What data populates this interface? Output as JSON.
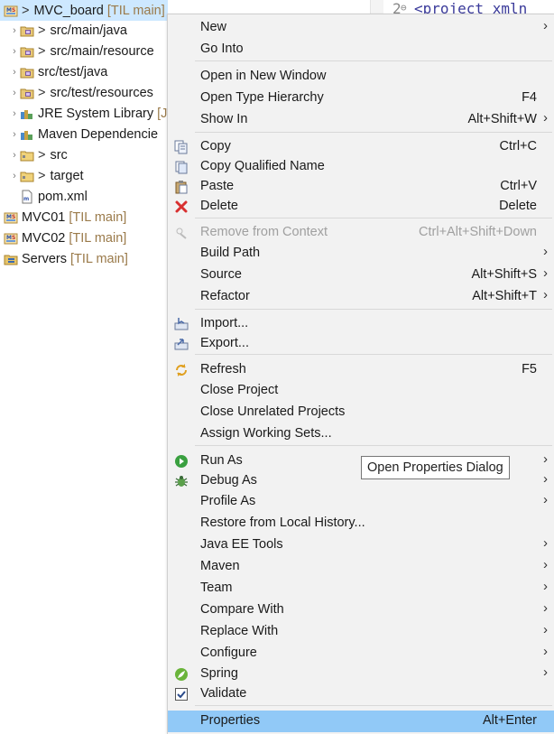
{
  "explorer": {
    "items": [
      {
        "name": "tree-item-mvc-board",
        "icon": "maven-project-icon",
        "label": "MVC_board",
        "suffix": "[TIL main]",
        "prefix": ">",
        "chevron": "",
        "selected": true
      },
      {
        "name": "tree-item-src-main-java",
        "icon": "source-folder-icon",
        "label": "src/main/java",
        "prefix": ">",
        "chevron": "›"
      },
      {
        "name": "tree-item-src-main-resources",
        "icon": "source-folder-icon",
        "label": "src/main/resource",
        "prefix": ">",
        "chevron": "›"
      },
      {
        "name": "tree-item-src-test-java",
        "icon": "source-folder-icon",
        "label": "src/test/java",
        "prefix": "",
        "chevron": "›"
      },
      {
        "name": "tree-item-src-test-resources",
        "icon": "source-folder-icon",
        "label": "src/test/resources",
        "prefix": ">",
        "chevron": "›"
      },
      {
        "name": "tree-item-jre-system-library",
        "icon": "library-icon",
        "label": "JRE System Library",
        "suffix": "[J",
        "prefix": "",
        "chevron": "›"
      },
      {
        "name": "tree-item-maven-dependencies",
        "icon": "library-icon",
        "label": "Maven Dependencie",
        "prefix": "",
        "chevron": "›"
      },
      {
        "name": "tree-item-src",
        "icon": "folder-icon",
        "label": "src",
        "prefix": ">",
        "chevron": "›"
      },
      {
        "name": "tree-item-target",
        "icon": "folder-icon",
        "label": "target",
        "prefix": ">",
        "chevron": "›"
      },
      {
        "name": "tree-item-pom-xml",
        "icon": "xml-file-icon",
        "label": "pom.xml",
        "prefix": "",
        "chevron": ""
      },
      {
        "name": "tree-item-mvc01",
        "icon": "maven-project-icon",
        "label": "MVC01",
        "suffix": "[TIL main]",
        "prefix": "",
        "chevron": ""
      },
      {
        "name": "tree-item-mvc02",
        "icon": "maven-project-icon",
        "label": "MVC02",
        "suffix": "[TIL main]",
        "prefix": "",
        "chevron": ""
      },
      {
        "name": "tree-item-servers",
        "icon": "servers-folder-icon",
        "label": "Servers",
        "suffix": "[TIL main]",
        "prefix": "",
        "chevron": ""
      }
    ]
  },
  "editor": {
    "line_number": "2",
    "fold_marker": "⊖",
    "code": "<project xmln"
  },
  "menu": {
    "items": [
      {
        "name": "menu-item-new",
        "label": "New",
        "shortcut": "",
        "submenu": true,
        "icon": ""
      },
      {
        "name": "menu-item-go-into",
        "label": "Go Into",
        "shortcut": "",
        "submenu": false,
        "icon": ""
      },
      {
        "sep": true
      },
      {
        "name": "menu-item-open-in-new-window",
        "label": "Open in New Window",
        "shortcut": "",
        "submenu": false,
        "icon": ""
      },
      {
        "name": "menu-item-open-type-hierarchy",
        "label": "Open Type Hierarchy",
        "shortcut": "F4",
        "submenu": false,
        "icon": ""
      },
      {
        "name": "menu-item-show-in",
        "label": "Show In",
        "shortcut": "Alt+Shift+W",
        "submenu": true,
        "icon": ""
      },
      {
        "sep": true
      },
      {
        "name": "menu-item-copy",
        "label": "Copy",
        "shortcut": "Ctrl+C",
        "submenu": false,
        "icon": "copy-icon"
      },
      {
        "name": "menu-item-copy-qualified-name",
        "label": "Copy Qualified Name",
        "shortcut": "",
        "submenu": false,
        "icon": "copy-qualified-icon"
      },
      {
        "name": "menu-item-paste",
        "label": "Paste",
        "shortcut": "Ctrl+V",
        "submenu": false,
        "icon": "paste-icon"
      },
      {
        "name": "menu-item-delete",
        "label": "Delete",
        "shortcut": "Delete",
        "submenu": false,
        "icon": "delete-icon"
      },
      {
        "sep": true
      },
      {
        "name": "menu-item-remove-from-context",
        "label": "Remove from Context",
        "shortcut": "Ctrl+Alt+Shift+Down",
        "submenu": false,
        "icon": "remove-context-icon",
        "disabled": true
      },
      {
        "name": "menu-item-build-path",
        "label": "Build Path",
        "shortcut": "",
        "submenu": true,
        "icon": ""
      },
      {
        "name": "menu-item-source",
        "label": "Source",
        "shortcut": "Alt+Shift+S",
        "submenu": true,
        "icon": ""
      },
      {
        "name": "menu-item-refactor",
        "label": "Refactor",
        "shortcut": "Alt+Shift+T",
        "submenu": true,
        "icon": ""
      },
      {
        "sep": true
      },
      {
        "name": "menu-item-import",
        "label": "Import...",
        "shortcut": "",
        "submenu": false,
        "icon": "import-icon"
      },
      {
        "name": "menu-item-export",
        "label": "Export...",
        "shortcut": "",
        "submenu": false,
        "icon": "export-icon"
      },
      {
        "sep": true
      },
      {
        "name": "menu-item-refresh",
        "label": "Refresh",
        "shortcut": "F5",
        "submenu": false,
        "icon": "refresh-icon"
      },
      {
        "name": "menu-item-close-project",
        "label": "Close Project",
        "shortcut": "",
        "submenu": false,
        "icon": ""
      },
      {
        "name": "menu-item-close-unrelated-projects",
        "label": "Close Unrelated Projects",
        "shortcut": "",
        "submenu": false,
        "icon": ""
      },
      {
        "name": "menu-item-assign-working-sets",
        "label": "Assign Working Sets...",
        "shortcut": "",
        "submenu": false,
        "icon": ""
      },
      {
        "sep": true
      },
      {
        "name": "menu-item-run-as",
        "label": "Run As",
        "shortcut": "",
        "submenu": true,
        "icon": "run-icon"
      },
      {
        "name": "menu-item-debug-as",
        "label": "Debug As",
        "shortcut": "",
        "submenu": true,
        "icon": "debug-icon"
      },
      {
        "name": "menu-item-profile-as",
        "label": "Profile As",
        "shortcut": "",
        "submenu": true,
        "icon": ""
      },
      {
        "name": "menu-item-restore-from-local-history",
        "label": "Restore from Local History...",
        "shortcut": "",
        "submenu": false,
        "icon": ""
      },
      {
        "name": "menu-item-java-ee-tools",
        "label": "Java EE Tools",
        "shortcut": "",
        "submenu": true,
        "icon": ""
      },
      {
        "name": "menu-item-maven",
        "label": "Maven",
        "shortcut": "",
        "submenu": true,
        "icon": ""
      },
      {
        "name": "menu-item-team",
        "label": "Team",
        "shortcut": "",
        "submenu": true,
        "icon": ""
      },
      {
        "name": "menu-item-compare-with",
        "label": "Compare With",
        "shortcut": "",
        "submenu": true,
        "icon": ""
      },
      {
        "name": "menu-item-replace-with",
        "label": "Replace With",
        "shortcut": "",
        "submenu": true,
        "icon": ""
      },
      {
        "name": "menu-item-configure",
        "label": "Configure",
        "shortcut": "",
        "submenu": true,
        "icon": ""
      },
      {
        "name": "menu-item-spring",
        "label": "Spring",
        "shortcut": "",
        "submenu": true,
        "icon": "spring-icon"
      },
      {
        "name": "menu-item-validate",
        "label": "Validate",
        "shortcut": "",
        "submenu": false,
        "icon": "validate-checkbox-icon"
      },
      {
        "sep": true
      },
      {
        "name": "menu-item-properties",
        "label": "Properties",
        "shortcut": "Alt+Enter",
        "submenu": false,
        "icon": "",
        "hover": true
      }
    ]
  },
  "tooltip": {
    "text": "Open Properties Dialog"
  },
  "colors": {
    "selection": "#cde8ff",
    "menu_background": "#f2f2f2",
    "menu_hover": "#91c9f7",
    "git_suffix": "#9a7a4a",
    "disabled_text": "#a0a0a0"
  }
}
